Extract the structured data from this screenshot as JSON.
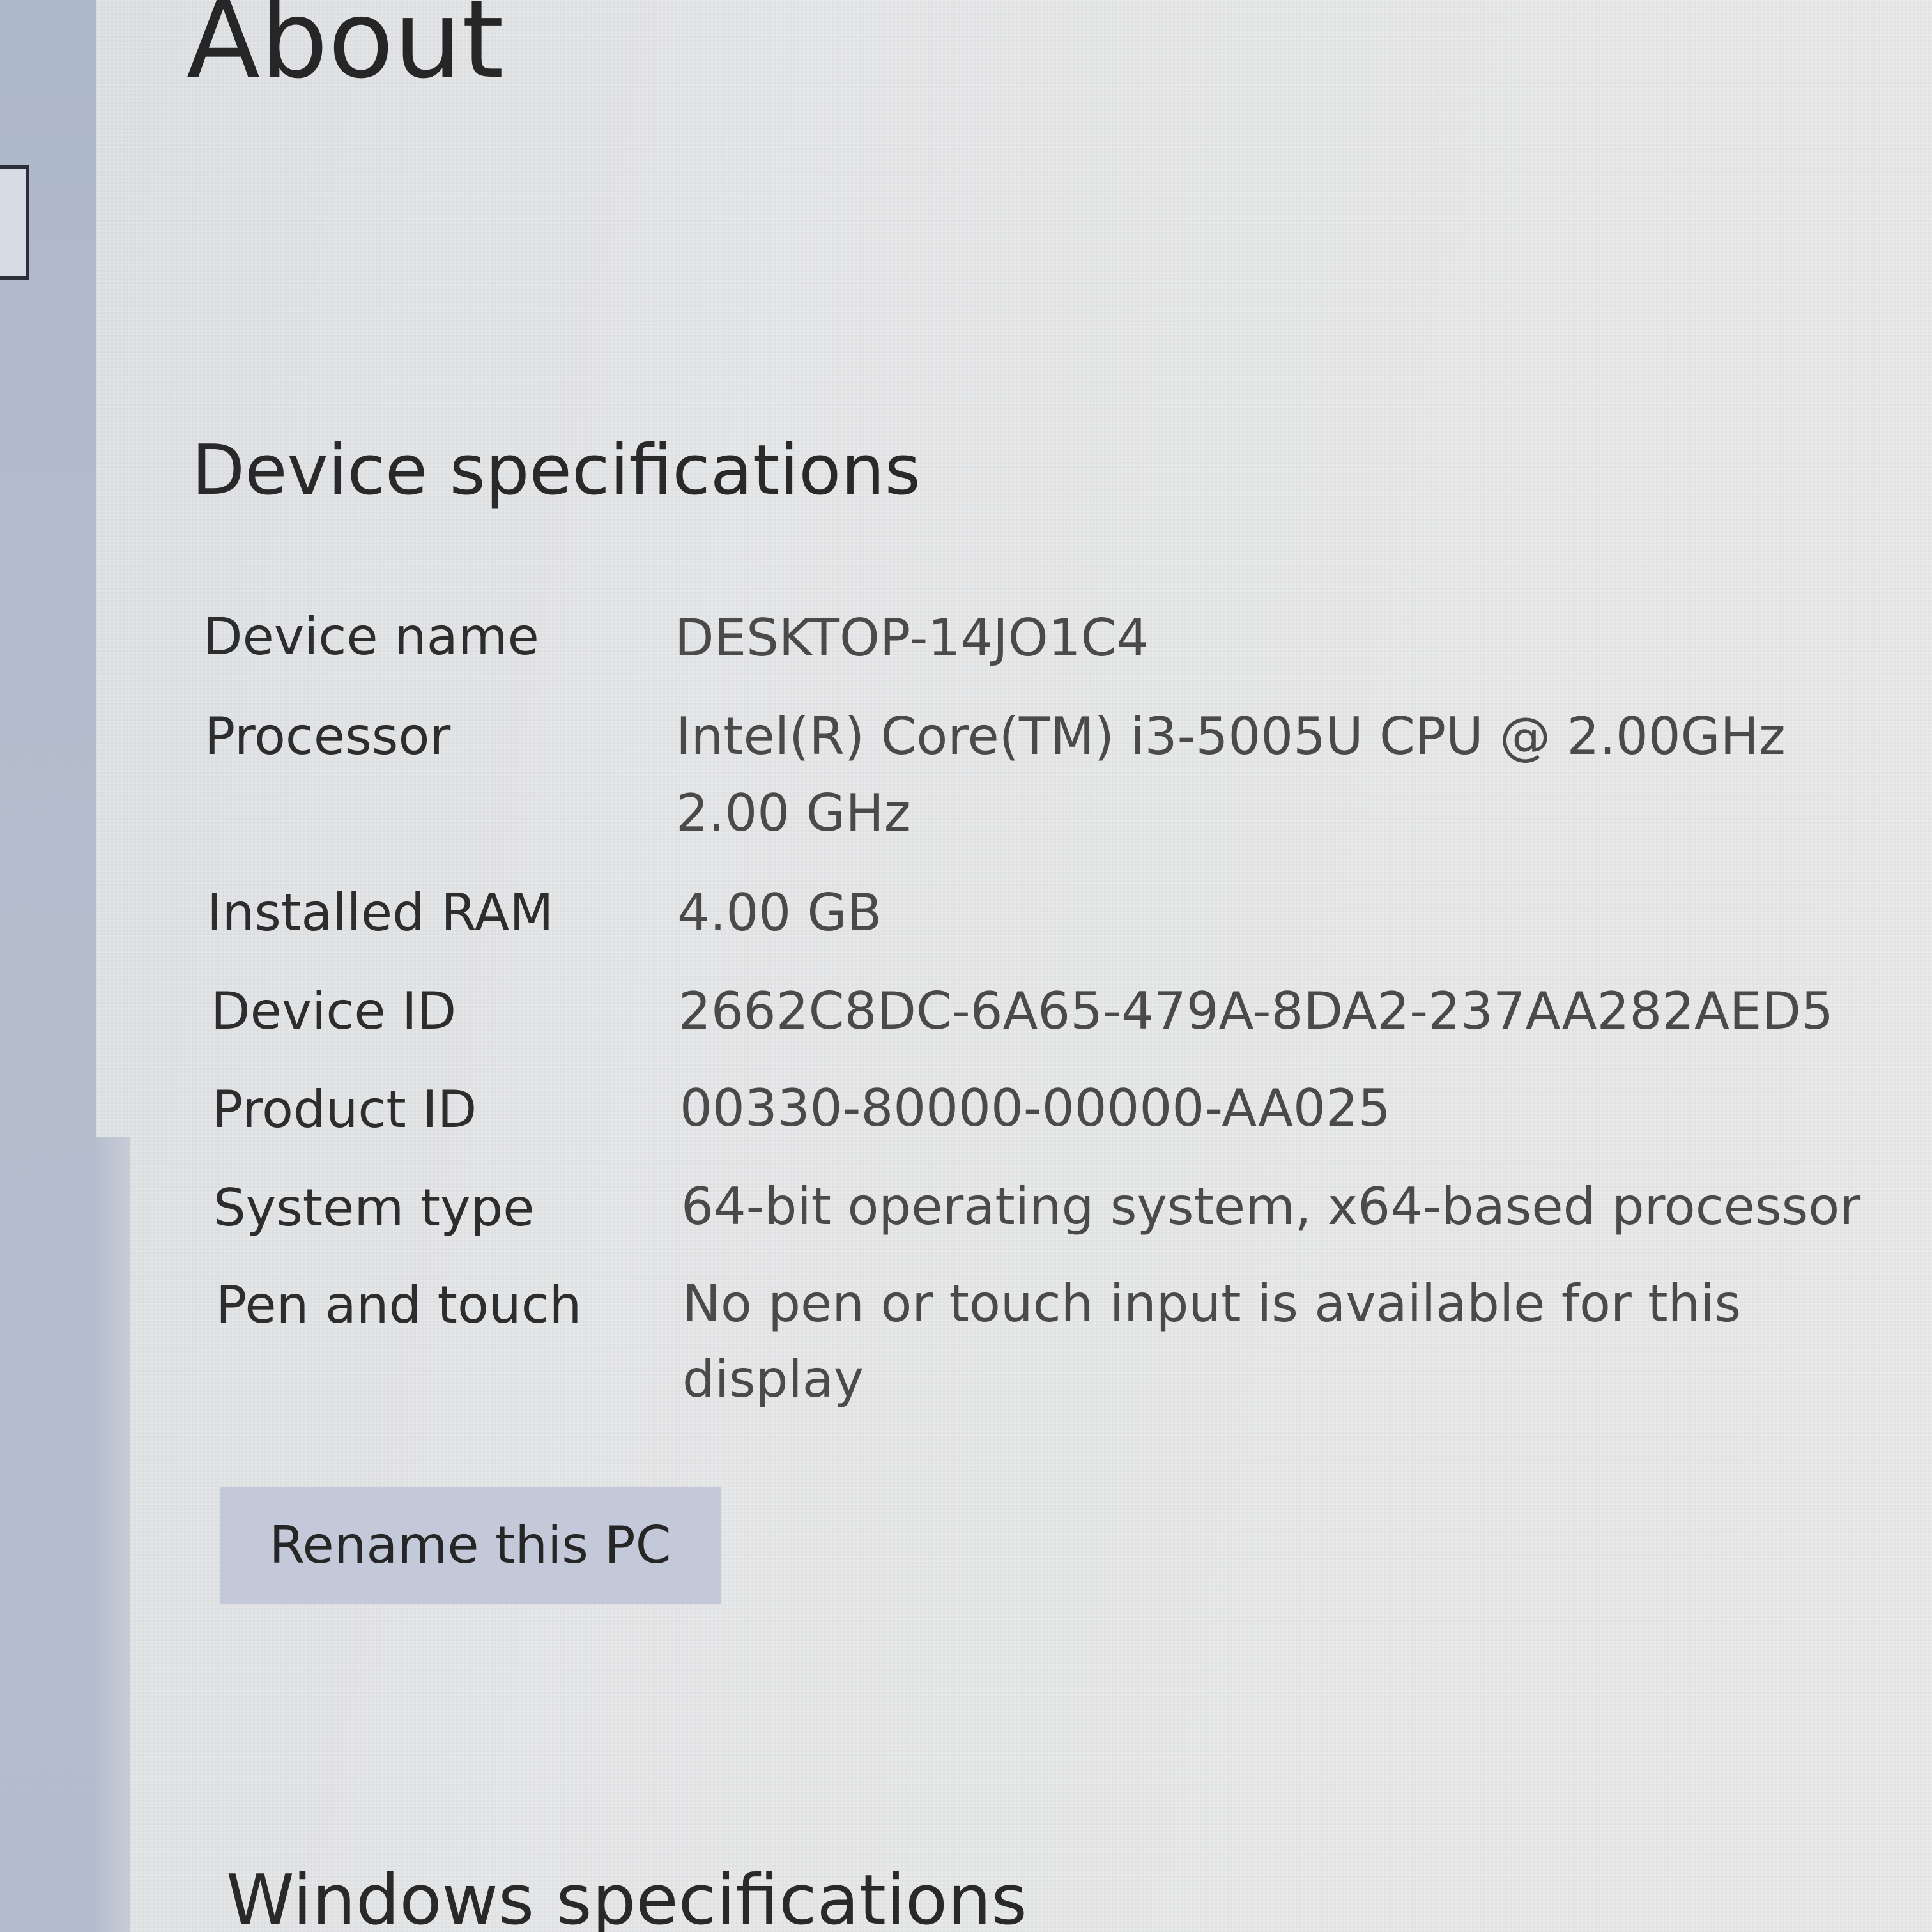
{
  "page": {
    "title": "About"
  },
  "device_specifications": {
    "heading": "Device specifications",
    "rows": [
      {
        "label": "Device name",
        "value_lines": [
          "DESKTOP-14JO1C4"
        ]
      },
      {
        "label": "Processor",
        "value_lines": [
          "Intel(R) Core(TM) i3-5005U CPU @ 2.00GHz",
          "2.00 GHz"
        ]
      },
      {
        "label": "Installed RAM",
        "value_lines": [
          "4.00 GB"
        ]
      },
      {
        "label": "Device ID",
        "value_lines": [
          "2662C8DC-6A65-479A-8DA2-237AA282AED5"
        ]
      },
      {
        "label": "Product ID",
        "value_lines": [
          "00330-80000-00000-AA025"
        ]
      },
      {
        "label": "System type",
        "value_lines": [
          "64-bit operating system, x64-based processor"
        ]
      },
      {
        "label": "Pen and touch",
        "value_lines": [
          "No pen or touch input is available for this",
          "display"
        ]
      }
    ],
    "rename_button_label": "Rename this PC"
  },
  "windows_specifications": {
    "heading": "Windows specifications"
  },
  "colors": {
    "left_rail": "#b3bccd",
    "button_bg": "#c3c9d8",
    "page_bg": "#e8e9ea"
  }
}
